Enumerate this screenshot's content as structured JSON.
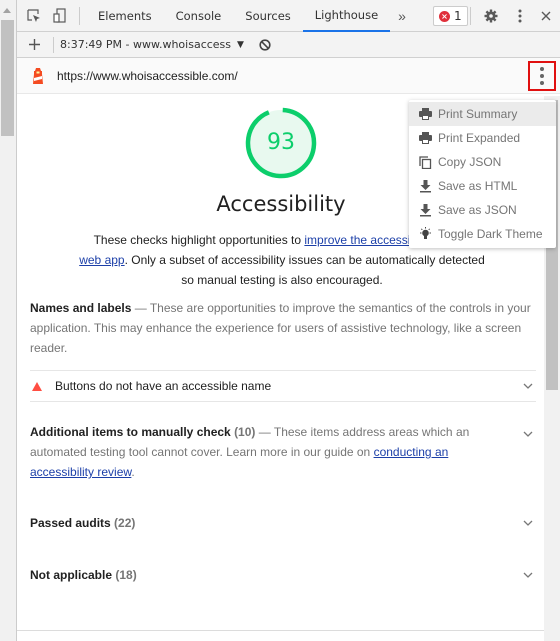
{
  "devtools": {
    "tabs": [
      {
        "label": "Elements",
        "active": false
      },
      {
        "label": "Console",
        "active": false
      },
      {
        "label": "Sources",
        "active": false
      },
      {
        "label": "Lighthouse",
        "active": true
      }
    ],
    "more_tabs_label": "»",
    "error_count": "1",
    "icons": [
      "inspect-element-icon",
      "device-toolbar-icon",
      "settings-gear-icon",
      "more-options-icon",
      "close-icon"
    ]
  },
  "toolbar2": {
    "new_report_label": "+",
    "report_select_value": "8:37:49 PM - www.whoisaccess",
    "clear_icon": "block-icon"
  },
  "lighthouse": {
    "url": "https://www.whoisaccessible.com/",
    "menu": {
      "items": [
        {
          "label": "Print Summary",
          "icon": "print-icon",
          "hovered": true
        },
        {
          "label": "Print Expanded",
          "icon": "print-icon",
          "hovered": false
        },
        {
          "label": "Copy JSON",
          "icon": "copy-icon",
          "hovered": false
        },
        {
          "label": "Save as HTML",
          "icon": "download-icon",
          "hovered": false
        },
        {
          "label": "Save as JSON",
          "icon": "download-icon",
          "hovered": false
        },
        {
          "label": "Toggle Dark Theme",
          "icon": "lightbulb-icon",
          "hovered": false
        }
      ]
    }
  },
  "report": {
    "score": {
      "value": "93",
      "fraction": 0.93,
      "color": "#0cce6b",
      "title": "Accessibility"
    },
    "description": {
      "pre_link": "These checks highlight opportunities to ",
      "link1": "improve the accessibility of your",
      "link1_visible": "improve the accessi",
      "link2": "web app",
      "post_link": ". Only a subset of accessibility issues can be automatically detected so manual testing is also encouraged."
    },
    "names_and_labels": {
      "title": "Names and labels",
      "dash": " — ",
      "description": "These are opportunities to improve the semantics of the controls in your application. This may enhance the experience for users of assistive technology, like a screen reader."
    },
    "failing_audits": [
      {
        "title": "Buttons do not have an accessible name",
        "status": "fail",
        "status_color": "#ff4e42"
      }
    ],
    "manual": {
      "title": "Additional items to manually check",
      "count": "(10)",
      "dash": " — ",
      "description": "These items address areas which an automated testing tool cannot cover. Learn more in our guide on ",
      "link": "conducting an accessibility review",
      "end": "."
    },
    "passed": {
      "title": "Passed audits",
      "count": "(22)"
    },
    "not_applicable": {
      "title": "Not applicable",
      "count": "(18)"
    }
  }
}
